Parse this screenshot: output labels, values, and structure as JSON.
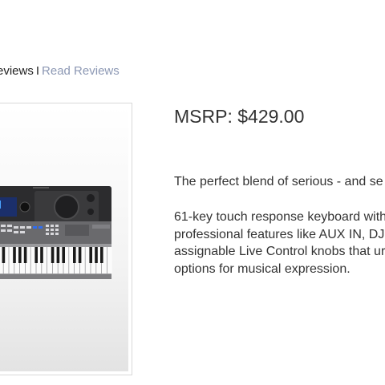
{
  "reviews": {
    "count_label": "eviews",
    "separator": "I",
    "read_link": "Read Reviews"
  },
  "product": {
    "image_icon": "keyboard-product-image",
    "msrp": "MSRP: $429.00",
    "tagline": "The perfect blend of serious - and se",
    "description_lines": [
      "61-key touch response keyboard with",
      "professional features like AUX IN, DJ",
      "assignable Live Control knobs that ur",
      "options for musical expression."
    ]
  },
  "colors": {
    "link": "#8c98b4",
    "text": "#333333",
    "frame_border": "#d9d9d9"
  }
}
